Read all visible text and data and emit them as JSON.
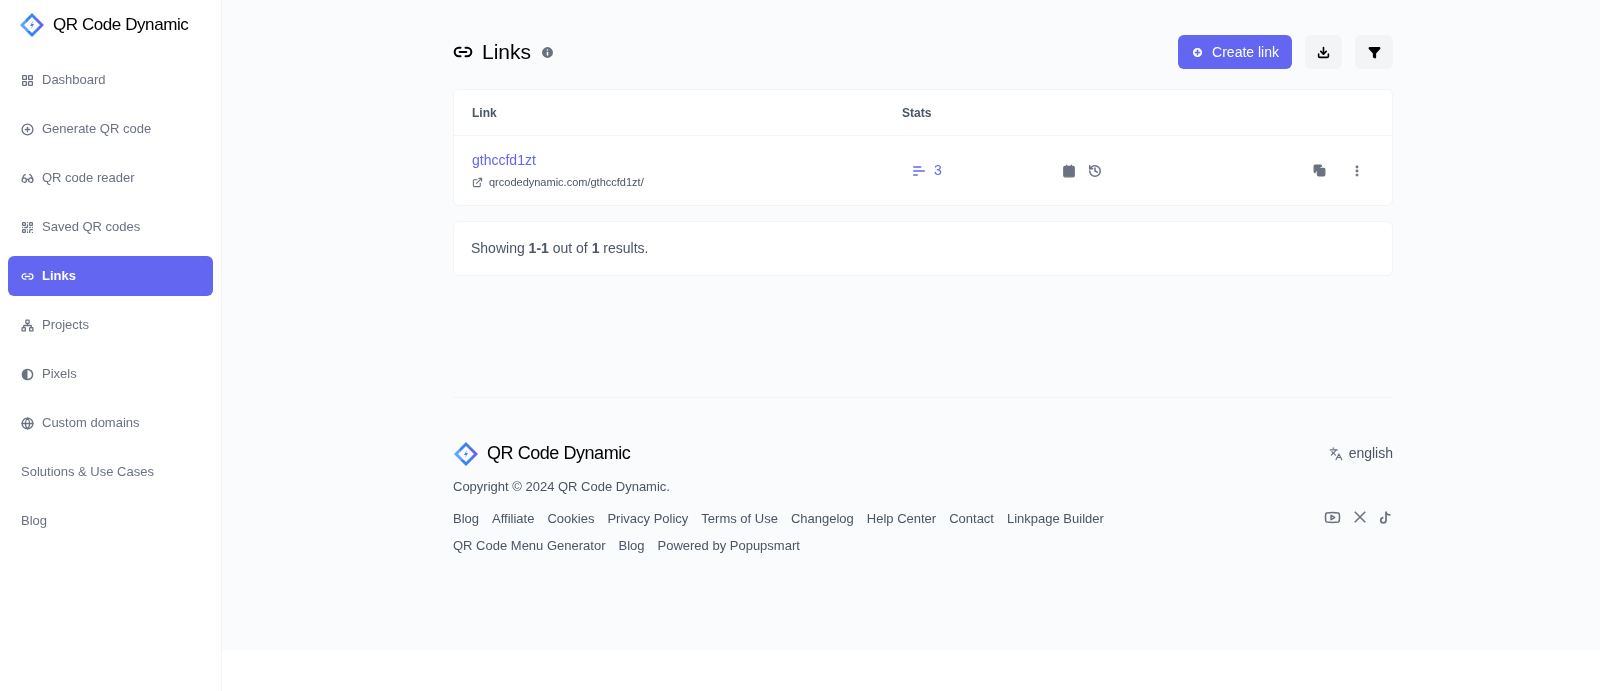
{
  "brand": "QR Code Dynamic",
  "sidebar": {
    "items": [
      {
        "label": "Dashboard",
        "kind": "grid",
        "selected": false
      },
      {
        "label": "Generate QR code",
        "kind": "plus",
        "selected": false
      },
      {
        "label": "QR code reader",
        "kind": "glasses",
        "selected": false
      },
      {
        "label": "Saved QR codes",
        "kind": "qr",
        "selected": false
      },
      {
        "label": "Links",
        "kind": "link",
        "selected": true
      },
      {
        "label": "Projects",
        "kind": "nodes",
        "selected": false
      },
      {
        "label": "Pixels",
        "kind": "contrast",
        "selected": false
      },
      {
        "label": "Custom domains",
        "kind": "globe",
        "selected": false
      },
      {
        "label": "Solutions & Use Cases",
        "kind": "plain",
        "selected": false
      },
      {
        "label": "Blog",
        "kind": "plain",
        "selected": false
      }
    ]
  },
  "page": {
    "title": "Links",
    "create_button": "Create link"
  },
  "table": {
    "columns": [
      "Link",
      "Stats"
    ],
    "rows": [
      {
        "name": "gthccfd1zt",
        "url": "qrcodedynamic.com/gthccfd1zt/",
        "stats": "3"
      }
    ]
  },
  "pagination": "Showing **1-1** out of **1** results.",
  "footer": {
    "brand": "QR Code Dynamic",
    "language": "english",
    "copyright": "Copyright © 2024 QR Code Dynamic.",
    "link_rows": [
      [
        "Blog",
        "Affiliate",
        "Cookies",
        "Privacy Policy",
        "Terms of Use",
        "Changelog",
        "Help Center",
        "Contact",
        "Linkpage Builder"
      ],
      [
        "QR Code Menu Generator",
        "Blog",
        "Powered by Popupsmart"
      ]
    ]
  }
}
